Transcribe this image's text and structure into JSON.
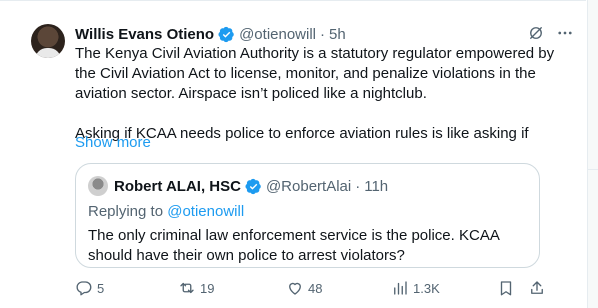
{
  "tweet": {
    "author_name": "Willis Evans Otieno",
    "handle": "@otienowill",
    "separator": "·",
    "time": "5h",
    "paragraph_1": "The Kenya Civil Aviation Authority is a statutory regulator empowered by the Civil Aviation Act to license, monitor, and penalize violations in the aviation sector. Airspace isn’t policed like a nightclub.",
    "paragraph_2": "Asking if KCAA needs police to enforce aviation rules is like asking if",
    "show_more": "Show more"
  },
  "quote": {
    "author_name": "Robert ALAI, HSC",
    "handle": "@RobertAlai",
    "separator": "·",
    "time": "11h",
    "replying_prefix": "Replying to",
    "replying_mention": "@otienowill",
    "text": "The only criminal law enforcement service is the police. KCAA should have their own police to arrest violators?"
  },
  "actions": {
    "replies": "5",
    "reposts": "19",
    "likes": "48",
    "views": "1.3K"
  },
  "icons": {
    "verified": "verified-badge-icon",
    "grok": "grok-icon",
    "more": "more-icon",
    "reply": "reply-icon",
    "repost": "repost-icon",
    "like": "heart-icon",
    "views": "views-icon",
    "bookmark": "bookmark-icon",
    "share": "share-icon"
  },
  "colors": {
    "accent": "#1d9bf0",
    "text_primary": "#0f1419",
    "text_secondary": "#536471",
    "border": "#cfd9de"
  }
}
